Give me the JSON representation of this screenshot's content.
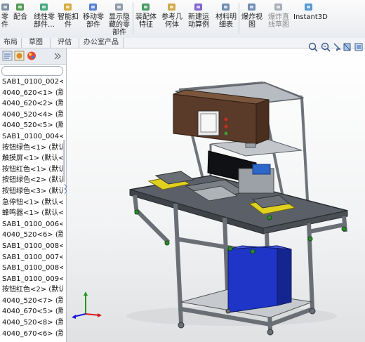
{
  "toolbar": {
    "buttons": [
      {
        "label": "零\n件",
        "icon": "part-icon"
      },
      {
        "label": "配合",
        "icon": "mate-icon"
      },
      {
        "label": "线性零\n部件…",
        "icon": "linear-pattern-icon"
      },
      {
        "label": "智能扣\n件",
        "icon": "smart-fastener-icon"
      },
      {
        "label": "移动零\n部件",
        "icon": "move-component-icon"
      },
      {
        "label": "显示隐\n藏的零\n部件",
        "icon": "show-hidden-icon"
      },
      {
        "label": "装配体\n特征",
        "icon": "assembly-feature-icon"
      },
      {
        "label": "参考几\n何体",
        "icon": "reference-geometry-icon"
      },
      {
        "label": "新建运\n动算例",
        "icon": "motion-study-icon"
      },
      {
        "label": "材料明\n细表",
        "icon": "bom-icon"
      },
      {
        "label": "爆炸视\n图",
        "icon": "exploded-view-icon"
      },
      {
        "label": "爆炸直\n线草图",
        "icon": "explode-line-sketch-icon"
      },
      {
        "label": "Instant3D",
        "icon": "instant3d-icon"
      }
    ]
  },
  "tabs": [
    "布局",
    "草图",
    "评估",
    "办公室产品"
  ],
  "feature_tree": {
    "items": [
      "SAB1_0100_002<",
      "4040_620<1> (默",
      "4040_620<2> (默",
      "4040_520<4> (默",
      "4040_520<5> (默",
      "SAB1_0100_004<",
      "按钮绿色<1> (默认",
      "触摸屏<1> (默认<",
      "按钮红色<1> (默认",
      "按钮绿色<2> (默认",
      "按钮绿色<3> (默认",
      "急停钮<1> (默认<",
      "蜂鸣器<1> (默认<",
      "SAB1_0100_006<",
      "4040_520<6> (默",
      "SAB1_0100_008<",
      "SAB1_0100_007<",
      "SAB1_0100_008<",
      "SAB1_0100_009<",
      "按钮红色<2> (默认",
      "4040_520<7> (默",
      "4040_670<5> (默",
      "4040_520<8> (默",
      "4040_670<6> (默"
    ]
  },
  "colors": {
    "frame": "#8c9198",
    "cabinet": "#5a3a28",
    "blue_box": "#1f35c8",
    "green": "#2e8b2e",
    "yellow": "#e0d020"
  }
}
